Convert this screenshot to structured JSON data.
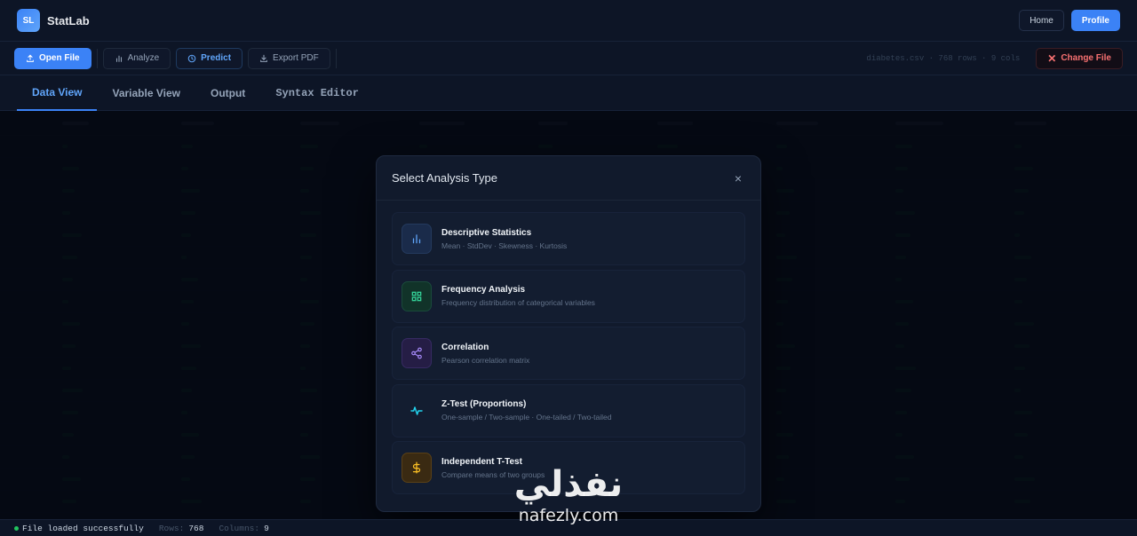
{
  "header": {
    "logo": "SL",
    "title": "StatLab",
    "home_label": "Home",
    "profile_label": "Profile"
  },
  "toolbar": {
    "open_file": "Open File",
    "analyze": "Analyze",
    "predict": "Predict",
    "export_pdf": "Export PDF",
    "file_info": "diabetes.csv · 768 rows · 9 cols",
    "change_file": "Change File"
  },
  "tabs": [
    {
      "label": "Data View",
      "active": true
    },
    {
      "label": "Variable View",
      "active": false
    },
    {
      "label": "Output",
      "active": false
    },
    {
      "label": "Syntax Editor",
      "active": false
    }
  ],
  "modal": {
    "title": "Select Analysis Type",
    "close": "×",
    "options": [
      {
        "title": "Descriptive Statistics",
        "desc": "Mean · StdDev · Skewness · Kurtosis",
        "icon": "bar-chart-icon",
        "color": "#60a5fa"
      },
      {
        "title": "Frequency Analysis",
        "desc": "Frequency distribution of categorical variables",
        "icon": "grid-icon",
        "color": "#34d399"
      },
      {
        "title": "Correlation",
        "desc": "Pearson correlation matrix",
        "icon": "share-nodes-icon",
        "color": "#a78bfa"
      },
      {
        "title": "Z-Test (Proportions)",
        "desc": "One-sample / Two-sample · One-tailed / Two-tailed",
        "icon": "pulse-icon",
        "color": "#22d3ee"
      },
      {
        "title": "Independent T-Test",
        "desc": "Compare means of two groups",
        "icon": "dollar-icon",
        "color": "#fbbf24"
      }
    ]
  },
  "status": {
    "message": "File loaded successfully",
    "rows_label": "Rows:",
    "rows_value": "768",
    "cols_label": "Columns:",
    "cols_value": "9"
  },
  "watermark": {
    "arabic": "نفذلي",
    "latin": "nafezly.com"
  }
}
